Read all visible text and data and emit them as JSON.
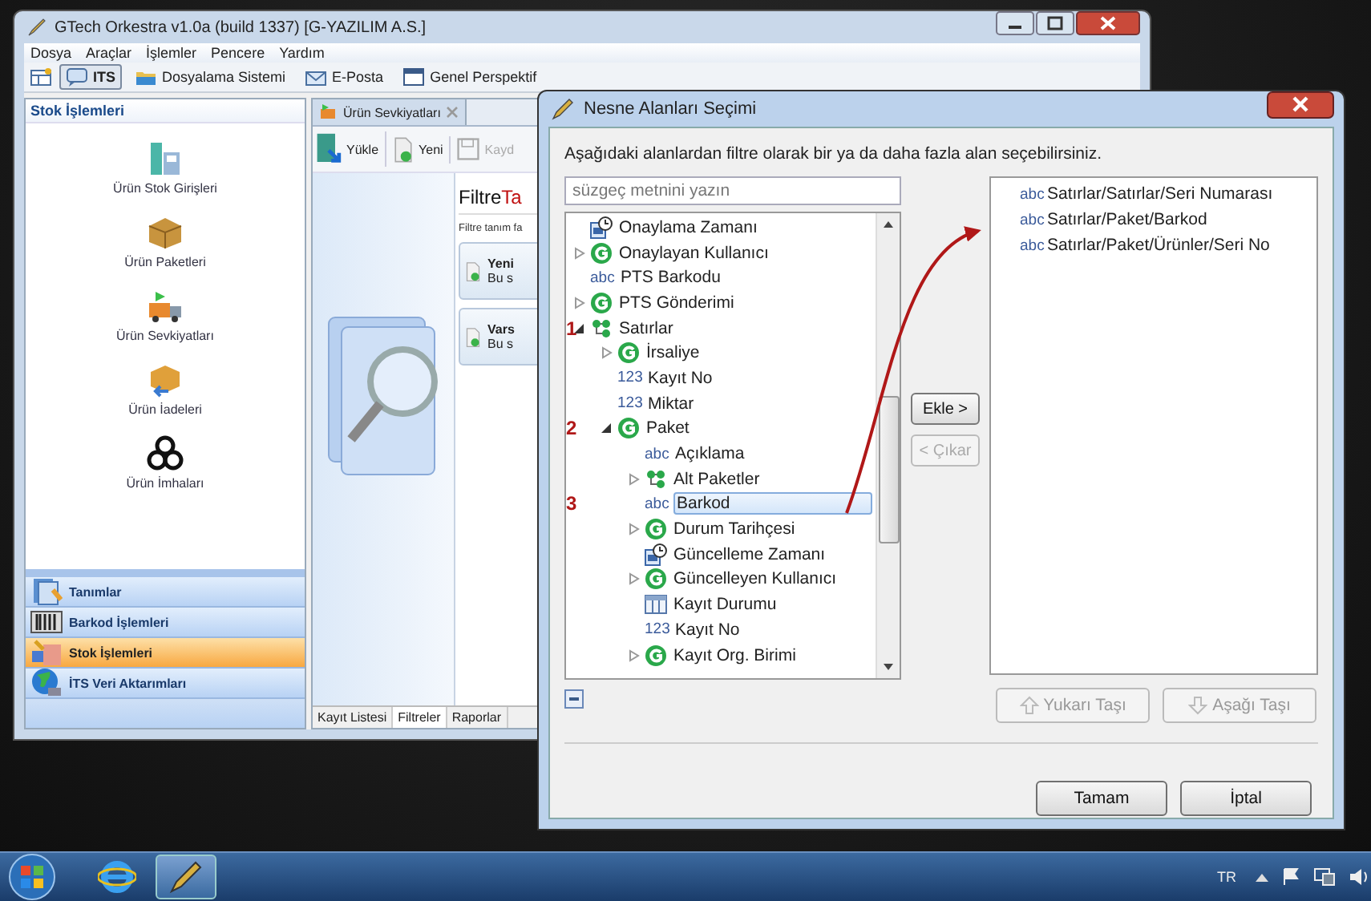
{
  "main_window": {
    "title": "GTech Orkestra v1.0a (build 1337) [G-YAZILIM A.S.]",
    "menu": [
      "Dosya",
      "Araçlar",
      "İşlemler",
      "Pencere",
      "Yardım"
    ],
    "toolbar": [
      {
        "label": "ITS",
        "kind": "its",
        "selected": true
      },
      {
        "label": "Dosyalama Sistemi",
        "kind": "folder",
        "selected": false
      },
      {
        "label": "E-Posta",
        "kind": "mail",
        "selected": false
      },
      {
        "label": "Genel Perspektif",
        "kind": "window",
        "selected": false
      }
    ],
    "sidebar": {
      "title": "Stok İşlemleri",
      "items": [
        {
          "label": "Ürün Stok Girişleri",
          "kind": "scanner"
        },
        {
          "label": "Ürün Paketleri",
          "kind": "box"
        },
        {
          "label": "Ürün Sevkiyatları",
          "kind": "truck"
        },
        {
          "label": "Ürün İadeleri",
          "kind": "return"
        },
        {
          "label": "Ürün İmhaları",
          "kind": "hazard"
        }
      ],
      "nav": [
        {
          "label": "Tanımlar",
          "kind": "definitions",
          "selected": false
        },
        {
          "label": "Barkod İşlemleri",
          "kind": "barcode",
          "selected": false
        },
        {
          "label": "Stok İşlemleri",
          "kind": "stock",
          "selected": true
        },
        {
          "label": "İTS Veri Aktarımları",
          "kind": "globe",
          "selected": false
        }
      ]
    },
    "editor": {
      "tab": "Ürün Sevkiyatları",
      "toolbar": [
        {
          "label": "Yükle",
          "kind": "load",
          "disabled": false
        },
        {
          "label": "Yeni",
          "kind": "new",
          "disabled": false
        },
        {
          "label": "Kayd",
          "kind": "save",
          "disabled": true
        }
      ],
      "title": "Filtre",
      "title_accent": "Ta",
      "description": "Filtre tanım fa",
      "cards": [
        {
          "title": "Yeni",
          "text": "Bu s"
        },
        {
          "title": "Vars",
          "text": "Bu s"
        }
      ],
      "bottom_tabs": [
        {
          "label": "Kayıt Listesi",
          "selected": false
        },
        {
          "label": "Filtreler",
          "selected": true
        },
        {
          "label": "Raporlar",
          "selected": false
        }
      ]
    }
  },
  "dialog": {
    "title": "Nesne Alanları Seçimi",
    "instruction": "Aşağıdaki alanlardan filtre olarak bir ya da daha fazla alan seçebilirsiniz.",
    "filter": {
      "placeholder": "süzgeç metnini yazın"
    },
    "tree": [
      {
        "label": "Onaylama Zamanı",
        "kind": "datetime",
        "selected": false
      },
      {
        "label": "Onaylayan Kullanıcı",
        "kind": "entity",
        "expanded": false,
        "selected": false
      },
      {
        "label": "PTS Barkodu",
        "kind": "typed",
        "type_label": "abc",
        "selected": false
      },
      {
        "label": "PTS Gönderimi",
        "kind": "entity",
        "expanded": false,
        "selected": false
      },
      {
        "label": "Satırlar",
        "kind": "collection",
        "expanded": true,
        "annotation": "1",
        "selected": false,
        "children": [
          {
            "label": "İrsaliye",
            "kind": "entity",
            "expanded": false,
            "selected": false
          },
          {
            "label": "Kayıt No",
            "kind": "typed",
            "type_label": "123",
            "selected": false
          },
          {
            "label": "Miktar",
            "kind": "typed",
            "type_label": "123",
            "selected": false
          },
          {
            "label": "Paket",
            "kind": "entity",
            "expanded": true,
            "annotation": "2",
            "selected": false,
            "children": [
              {
                "label": "Açıklama",
                "kind": "typed",
                "type_label": "abc",
                "selected": false
              },
              {
                "label": "Alt Paketler",
                "kind": "collection",
                "expanded": false,
                "selected": false
              },
              {
                "label": "Barkod",
                "kind": "typed",
                "type_label": "abc",
                "annotation": "3",
                "selected": true
              },
              {
                "label": "Durum Tarihçesi",
                "kind": "entity",
                "expanded": false,
                "selected": false
              },
              {
                "label": "Güncelleme Zamanı",
                "kind": "datetime",
                "selected": false
              },
              {
                "label": "Güncelleyen Kullanıcı",
                "kind": "entity",
                "expanded": false,
                "selected": false
              },
              {
                "label": "Kayıt Durumu",
                "kind": "status",
                "selected": false
              },
              {
                "label": "Kayıt No",
                "kind": "typed",
                "type_label": "123",
                "selected": false
              },
              {
                "label": "Kayıt Org. Birimi",
                "kind": "entity",
                "expanded": false,
                "selected": false
              }
            ]
          }
        ]
      }
    ],
    "add_button": {
      "label": "Ekle >",
      "disabled": false
    },
    "remove_button": {
      "label": "< Çıkar",
      "disabled": true
    },
    "selected_fields": [
      {
        "type_label": "abc",
        "label": "Satırlar/Satırlar/Seri Numarası"
      },
      {
        "type_label": "abc",
        "label": "Satırlar/Paket/Barkod"
      },
      {
        "type_label": "abc",
        "label": "Satırlar/Paket/Ürünler/Seri No"
      }
    ],
    "move_up": {
      "label": "Yukarı Taşı",
      "disabled": true
    },
    "move_down": {
      "label": "Aşağı Taşı",
      "disabled": true
    },
    "ok_button": "Tamam",
    "cancel_button": "İptal"
  },
  "taskbar": {
    "language": "TR"
  }
}
